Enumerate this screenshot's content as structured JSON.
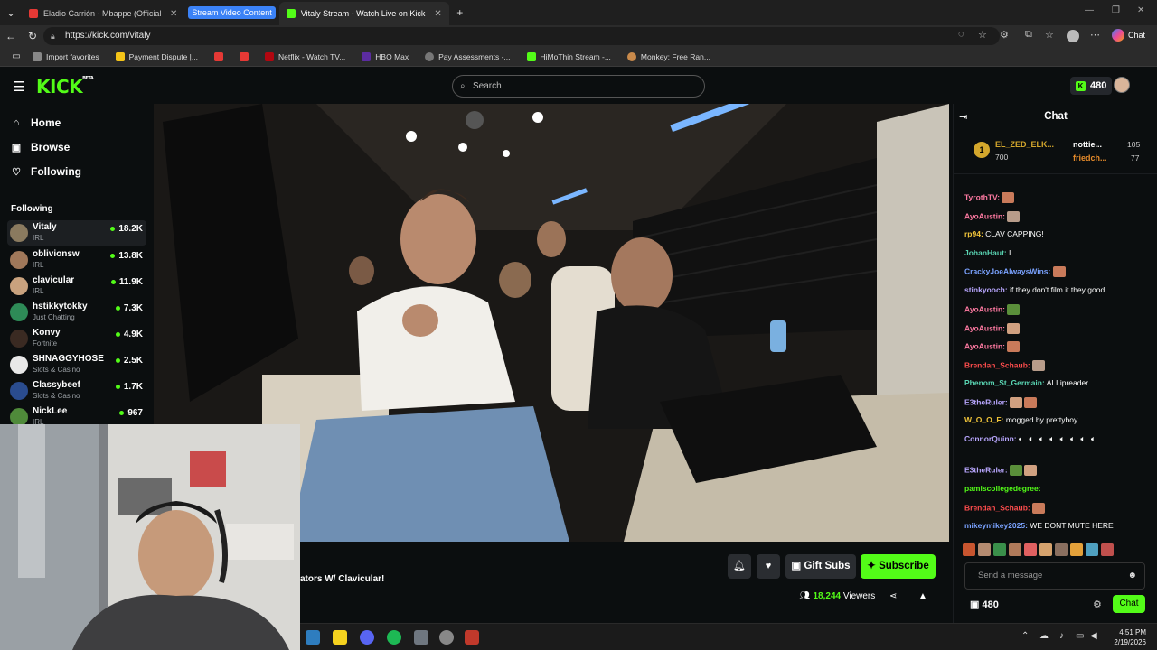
{
  "browser": {
    "tabs": [
      {
        "label": "Eladio Carrión - Mbappe (Official V",
        "color": "#e53935"
      },
      {
        "label": "Vitaly Stream - Watch Live on Kick",
        "color": "#53fc18"
      }
    ],
    "group_label": "Stream Video Content",
    "url": "https://kick.com/vitaly",
    "copilot_label": "Chat",
    "bookmarks": [
      "Import favorites",
      "Payment Dispute |...",
      "Netflix - Watch TV...",
      "HBO Max",
      "Pay Assessments -...",
      "HiMoThin Stream -...",
      "Monkey: Free Ran..."
    ]
  },
  "kick": {
    "logo": "KICK",
    "logo_badge": "BETA",
    "search_placeholder": "Search",
    "points": "480",
    "nav": [
      {
        "label": "Home",
        "icon": "home-icon"
      },
      {
        "label": "Browse",
        "icon": "browse-icon"
      },
      {
        "label": "Following",
        "icon": "heart-icon"
      }
    ],
    "following_heading": "Following",
    "channels": [
      {
        "name": "Vitaly",
        "category": "IRL",
        "viewers": "18.2K",
        "color": "#8a7a5f"
      },
      {
        "name": "oblivionsw",
        "category": "IRL",
        "viewers": "13.8K",
        "color": "#a0785a"
      },
      {
        "name": "clavicular",
        "category": "IRL",
        "viewers": "11.9K",
        "color": "#c9a27e"
      },
      {
        "name": "hstikkytokky",
        "category": "Just Chatting",
        "viewers": "7.3K",
        "color": "#2e8b57"
      },
      {
        "name": "Konvy",
        "category": "Fortnite",
        "viewers": "4.9K",
        "color": "#3a2a22"
      },
      {
        "name": "SHNAGGYHOSE",
        "category": "Slots & Casino",
        "viewers": "2.5K",
        "color": "#e8e8e8"
      },
      {
        "name": "Classybeef",
        "category": "Slots & Casino",
        "viewers": "1.7K",
        "color": "#2a4c8f"
      },
      {
        "name": "NickLee",
        "category": "IRL",
        "viewers": "967",
        "color": "#4f8a3a"
      }
    ]
  },
  "stream": {
    "title": "ators W/ Clavicular!",
    "gift_label": "Gift Subs",
    "subscribe_label": "Subscribe",
    "viewers": "18,244",
    "viewers_label": "Viewers"
  },
  "chat": {
    "title": "Chat",
    "leaderboard": [
      {
        "name": "EL_ZED_ELK...",
        "value": "700",
        "color": "#d4a72c"
      },
      {
        "name": "nottie...",
        "value": "105",
        "color": "#ffffff"
      },
      {
        "name": "friedch...",
        "value": "77",
        "color": "#e58a2a"
      }
    ],
    "messages": [
      {
        "user": "TyrothTV:",
        "text": "",
        "color": "#ff7aa2",
        "emotes": 1
      },
      {
        "user": "AyoAustin:",
        "text": "",
        "color": "#ff7aa2",
        "emotes": 1
      },
      {
        "user": "rp94:",
        "text": "CLAV CAPPING!",
        "color": "#f0c43a",
        "emotes": 0
      },
      {
        "user": "JohanHaut:",
        "text": "L",
        "color": "#5ad6b4",
        "emotes": 0
      },
      {
        "user": "CrackyJoeAlwaysWins:",
        "text": "",
        "color": "#7aa2ff",
        "emotes": 1
      },
      {
        "user": "stinkyooch:",
        "text": "if they don't film it they good",
        "color": "#b9a7ff",
        "emotes": 0
      },
      {
        "user": "AyoAustin:",
        "text": "",
        "color": "#ff7aa2",
        "emotes": 1
      },
      {
        "user": "AyoAustin:",
        "text": "",
        "color": "#ff7aa2",
        "emotes": 1
      },
      {
        "user": "AyoAustin:",
        "text": "",
        "color": "#ff7aa2",
        "emotes": 1
      },
      {
        "user": "Brendan_Schaub:",
        "text": "",
        "color": "#ff4d4d",
        "emotes": 1
      },
      {
        "user": "Phenom_St_Germain:",
        "text": "AI Lipreader",
        "color": "#5ad6b4",
        "emotes": 0
      },
      {
        "user": "E3theRuler:",
        "text": "",
        "color": "#b9a7ff",
        "emotes": 2
      },
      {
        "user": "W_O_O_F:",
        "text": "mogged by prettyboy",
        "color": "#f0c43a",
        "emotes": 0
      },
      {
        "user": "ConnorQuinn:",
        "text": "",
        "color": "#b9a7ff",
        "emotes": 0
      },
      {
        "user": "E3theRuler:",
        "text": "",
        "color": "#b9a7ff",
        "emotes": 2
      },
      {
        "user": "pamiscollegedegree:",
        "text": "",
        "color": "#53fc18",
        "emotes": 0
      },
      {
        "user": "Brendan_Schaub:",
        "text": "",
        "color": "#ff4d4d",
        "emotes": 1
      },
      {
        "user": "mikeymikey2025:",
        "text": "WE DONT MUTE HERE",
        "color": "#7aa2ff",
        "emotes": 0
      }
    ],
    "input_placeholder": "Send a message",
    "points": "480",
    "send_label": "Chat"
  },
  "taskbar": {
    "time": "4:51 PM",
    "date": "2/19/2026"
  }
}
